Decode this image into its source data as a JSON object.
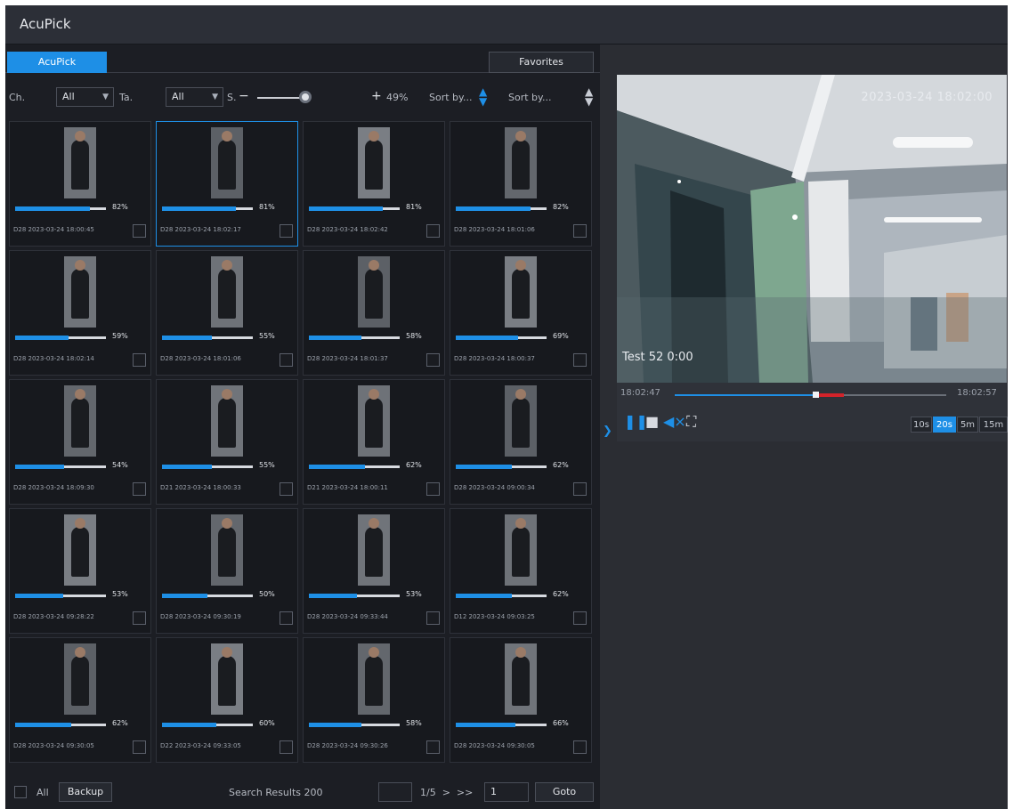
{
  "app": {
    "title": "AcuPick"
  },
  "tabs": {
    "active_label": "AcuPick",
    "favorites_label": "Favorites"
  },
  "filters": {
    "channel_label": "Ch.",
    "channel_value": "All",
    "type_label": "Ta.",
    "type_value": "All",
    "similarity_label": "S.",
    "similarity_value": "49%",
    "sort1": "Sort by...",
    "sort2": "Sort by..."
  },
  "results": [
    {
      "pct": "82%",
      "fill": 0.82,
      "ts": "D28 2023-03-24 18:00:45",
      "selected": false
    },
    {
      "pct": "81%",
      "fill": 0.81,
      "ts": "D28 2023-03-24 18:02:17",
      "selected": true
    },
    {
      "pct": "81%",
      "fill": 0.81,
      "ts": "D28 2023-03-24 18:02:42",
      "selected": false
    },
    {
      "pct": "82%",
      "fill": 0.82,
      "ts": "D28 2023-03-24 18:01:06",
      "selected": false
    },
    {
      "pct": "59%",
      "fill": 0.59,
      "ts": "D28 2023-03-24 18:02:14",
      "selected": false
    },
    {
      "pct": "55%",
      "fill": 0.55,
      "ts": "D28 2023-03-24 18:01:06",
      "selected": false
    },
    {
      "pct": "58%",
      "fill": 0.58,
      "ts": "D28 2023-03-24 18:01:37",
      "selected": false
    },
    {
      "pct": "69%",
      "fill": 0.69,
      "ts": "D28 2023-03-24 18:00:37",
      "selected": false
    },
    {
      "pct": "54%",
      "fill": 0.54,
      "ts": "D28 2023-03-24 18:09:30",
      "selected": false
    },
    {
      "pct": "55%",
      "fill": 0.55,
      "ts": "D21 2023-03-24 18:00:33",
      "selected": false
    },
    {
      "pct": "62%",
      "fill": 0.62,
      "ts": "D21 2023-03-24 18:00:11",
      "selected": false
    },
    {
      "pct": "62%",
      "fill": 0.62,
      "ts": "D28 2023-03-24 09:00:34",
      "selected": false
    },
    {
      "pct": "53%",
      "fill": 0.53,
      "ts": "D28 2023-03-24 09:28:22",
      "selected": false
    },
    {
      "pct": "50%",
      "fill": 0.5,
      "ts": "D28 2023-03-24 09:30:19",
      "selected": false
    },
    {
      "pct": "53%",
      "fill": 0.53,
      "ts": "D28 2023-03-24 09:33:44",
      "selected": false
    },
    {
      "pct": "62%",
      "fill": 0.62,
      "ts": "D12 2023-03-24 09:03:25",
      "selected": false
    },
    {
      "pct": "62%",
      "fill": 0.62,
      "ts": "D28 2023-03-24 09:30:05",
      "selected": false
    },
    {
      "pct": "60%",
      "fill": 0.6,
      "ts": "D22 2023-03-24 09:33:05",
      "selected": false
    },
    {
      "pct": "58%",
      "fill": 0.58,
      "ts": "D28 2023-03-24 09:30:26",
      "selected": false
    },
    {
      "pct": "66%",
      "fill": 0.66,
      "ts": "D28 2023-03-24 09:30:05",
      "selected": false
    }
  ],
  "footer": {
    "all_label": "All",
    "backup_label": "Backup",
    "search_results": "Search Results 200",
    "page_text": "1/5",
    "page_input": "1",
    "goto_label": "Goto"
  },
  "player": {
    "osd_top": "2023-03-24 18:02:00",
    "osd_bottom": "Test 52 0:00",
    "time_start": "18:02:47",
    "time_end": "18:02:57",
    "progress": 0.52,
    "speeds": [
      "10s",
      "20s",
      "5m",
      "15m"
    ],
    "active_speed": "20s"
  }
}
